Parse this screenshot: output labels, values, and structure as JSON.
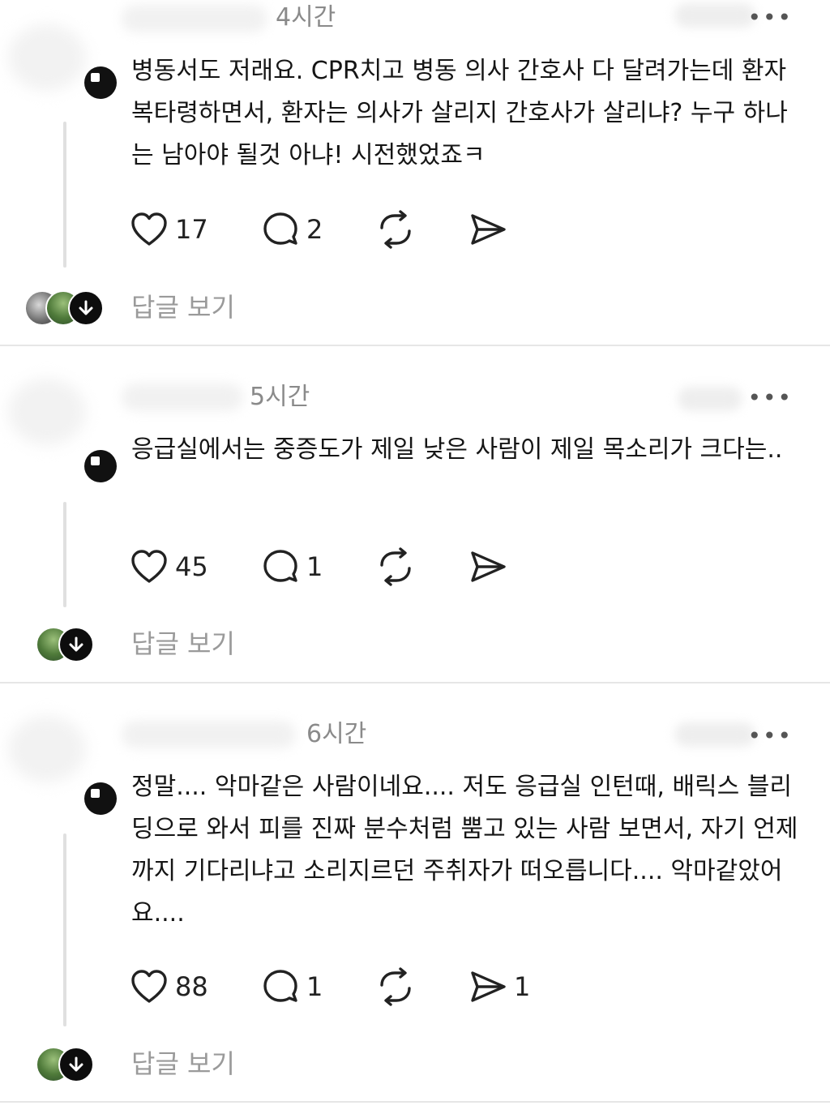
{
  "posts": [
    {
      "time": "4시간",
      "text": "병동서도 저래요. CPR치고 병동 의사 간호사 다 달려가는데 환자복타령하면서, 환자는 의사가 살리지 간호사가 살리냐? 누구 하나는 남아야 될것 아냐! 시전했었죠ㅋ",
      "likes": "17",
      "replies": "2",
      "shares": "",
      "reply_label": "답글 보기"
    },
    {
      "time": "5시간",
      "text": "응급실에서는 중증도가 제일 낮은 사람이 제일 목소리가 크다는..",
      "likes": "45",
      "replies": "1",
      "shares": "",
      "reply_label": "답글 보기"
    },
    {
      "time": "6시간",
      "text": "정말.... 악마같은 사람이네요.... 저도 응급실 인턴때, 배릭스 블리딩으로 와서 피를 진짜 분수처럼 뿜고 있는 사람 보면서, 자기 언제까지 기다리냐고 소리지르던 주취자가 떠오릅니다.... 악마같았어요....",
      "likes": "88",
      "replies": "1",
      "shares": "1",
      "reply_label": "답글 보기"
    }
  ],
  "icons": {
    "more": "more-horizontal-icon",
    "like": "heart-icon",
    "reply": "comment-icon",
    "repost": "repost-icon",
    "share": "send-icon",
    "expand": "arrow-down-icon"
  },
  "colors": {
    "background": "#ffffff",
    "text": "#151515",
    "muted": "#8a8a8a",
    "reply_label": "#9a9a9a",
    "divider": "#e6e6e6"
  }
}
